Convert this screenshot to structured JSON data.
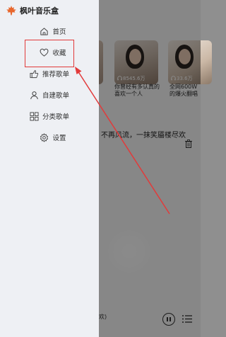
{
  "app": {
    "name": "枫叶音乐盒"
  },
  "drawer": {
    "items": [
      {
        "label": "首页",
        "icon": "home-icon"
      },
      {
        "label": "收藏",
        "icon": "heart-icon"
      },
      {
        "label": "推荐歌单",
        "icon": "thumbs-up-icon"
      },
      {
        "label": "自建歌单",
        "icon": "user-icon"
      },
      {
        "label": "分类歌单",
        "icon": "grid-icon"
      },
      {
        "label": "设置",
        "icon": "gear-icon"
      }
    ]
  },
  "background": {
    "cards": [
      {
        "title": "",
        "plays": ""
      },
      {
        "title": "你曾经有多认真的喜欢一个人",
        "plays": "8545.6万"
      },
      {
        "title": "全网600W的爆火翻唱",
        "plays": "33.6万"
      }
    ],
    "song_line": "不再风流，一抹笑靥楼尽欢",
    "bottom_text": "欢)"
  },
  "annotation": {
    "highlight_color": "#e23a3a"
  }
}
